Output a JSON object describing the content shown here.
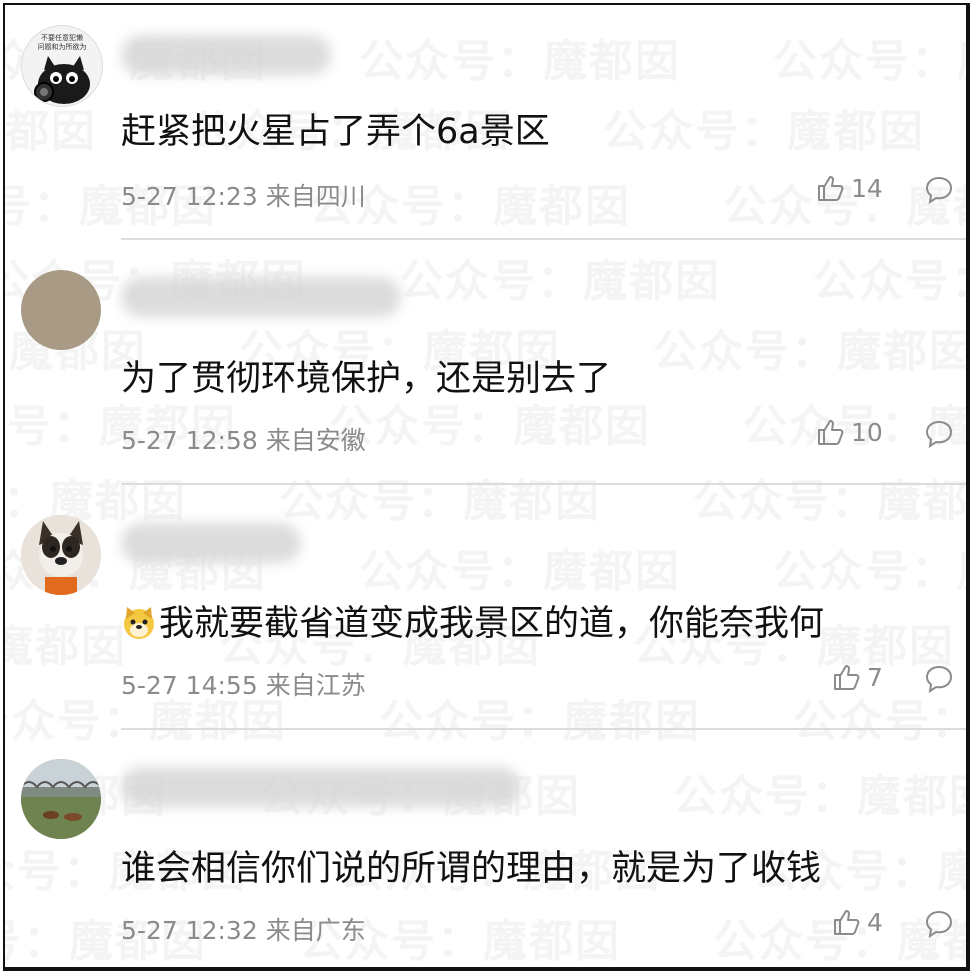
{
  "watermark": "公众号：魔都囡",
  "comments": [
    {
      "text": "赶紧把火星占了弄个6a景区",
      "time": "5-27 12:23",
      "location": "来自四川",
      "likes": "14",
      "emoji": ""
    },
    {
      "text": "为了贯彻环境保护，还是别去了",
      "time": "5-27 12:58",
      "location": "来自安徽",
      "likes": "10",
      "emoji": ""
    },
    {
      "text": "我就要截省道变成我景区的道，你能奈我何",
      "time": "5-27 14:55",
      "location": "来自江苏",
      "likes": "7",
      "emoji": "dog-face-emoji"
    },
    {
      "text": "谁会相信你们说的所谓的理由，就是为了收钱",
      "time": "5-27 12:32",
      "location": "来自广东",
      "likes": "4",
      "emoji": ""
    }
  ],
  "avatar1_caption": [
    "不要任意犯懒",
    "问题和为所欲为"
  ],
  "colors": {
    "text": "#111111",
    "meta": "#8b8b8b",
    "divider": "#dcdcdc",
    "frame": "#111111"
  }
}
